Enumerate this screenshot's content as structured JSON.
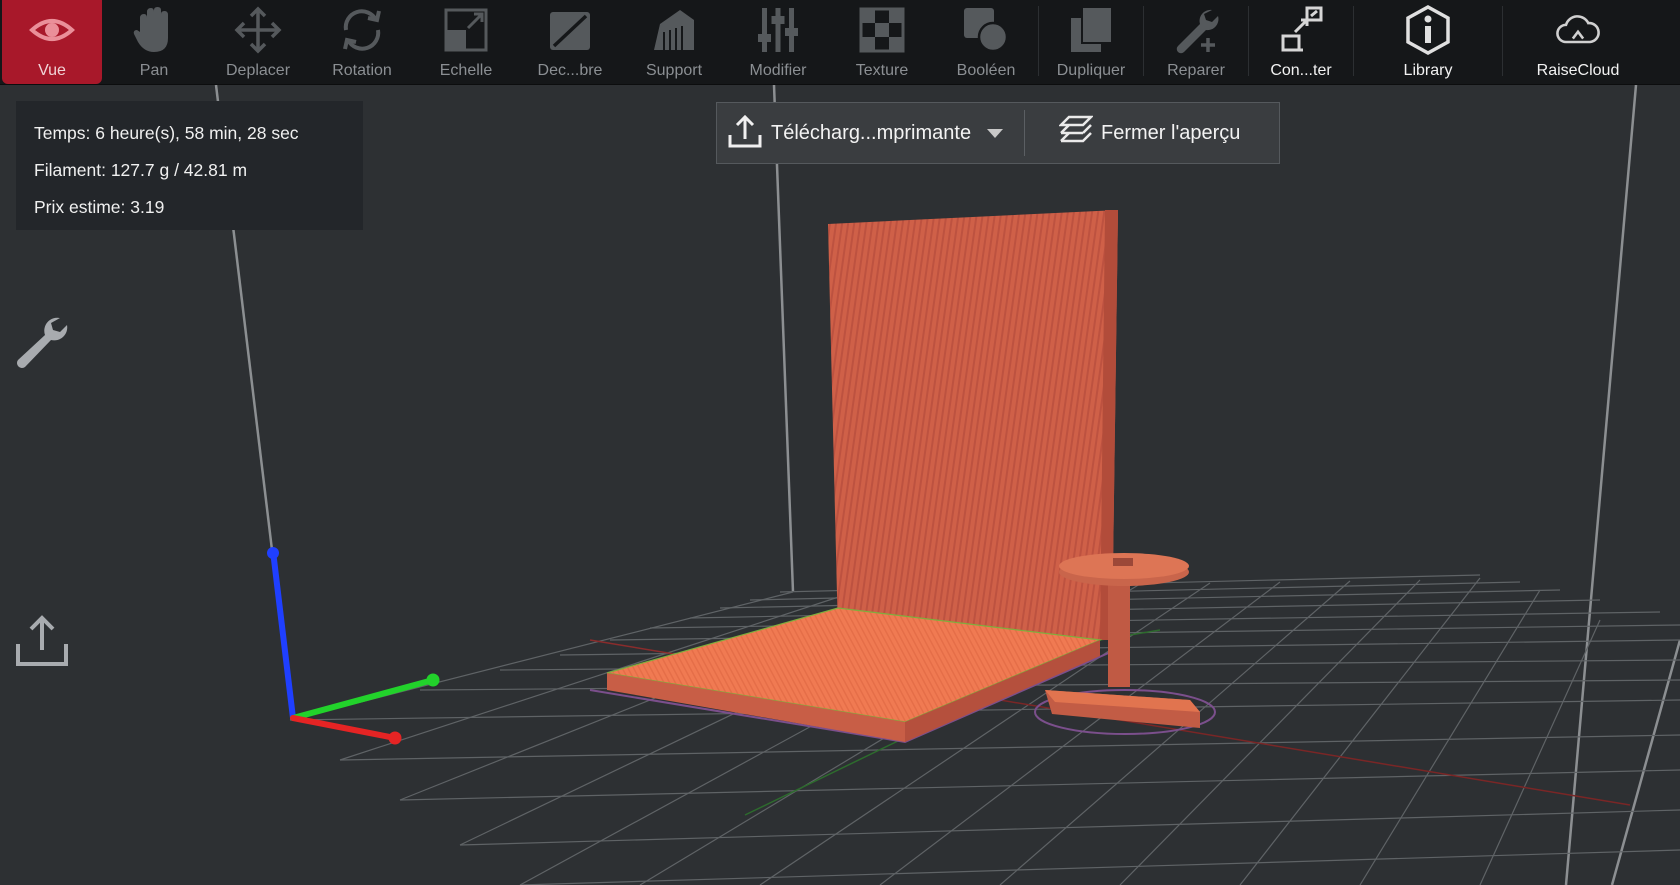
{
  "toolbar": {
    "items": [
      {
        "label": "Vue",
        "icon": "eye-icon",
        "state": "active"
      },
      {
        "label": "Pan",
        "icon": "hand-icon",
        "state": "disabled"
      },
      {
        "label": "Deplacer",
        "icon": "move-icon",
        "state": "disabled"
      },
      {
        "label": "Rotation",
        "icon": "rotate-icon",
        "state": "disabled"
      },
      {
        "label": "Echelle",
        "icon": "scale-icon",
        "state": "disabled"
      },
      {
        "label": "Dec...bre",
        "icon": "cut-icon",
        "state": "disabled"
      },
      {
        "label": "Support",
        "icon": "support-icon",
        "state": "disabled"
      },
      {
        "label": "Modifier",
        "icon": "sliders-icon",
        "state": "disabled"
      },
      {
        "label": "Texture",
        "icon": "checker-icon",
        "state": "disabled"
      },
      {
        "label": "Booléen",
        "icon": "boolean-icon",
        "state": "disabled"
      },
      {
        "label": "Dupliquer",
        "icon": "duplicate-icon",
        "state": "disabled"
      },
      {
        "label": "Reparer",
        "icon": "wrench-plus-icon",
        "state": "disabled"
      },
      {
        "label": "Con...ter",
        "icon": "connect-icon",
        "state": "enabled"
      },
      {
        "label": "Library",
        "icon": "info-icon",
        "state": "enabled"
      },
      {
        "label": "RaiseCloud",
        "icon": "cloud-icon",
        "state": "enabled"
      }
    ]
  },
  "stats": {
    "time": "Temps: 6 heure(s), 58 min, 28 sec",
    "filament": "Filament: 127.7 g / 42.81 m",
    "price": "Prix estime: 3.19"
  },
  "preview": {
    "upload_label": "Télécharg...mprimante",
    "close_label": "Fermer l'aperçu"
  },
  "sidebar": {
    "tools_icon": "wrench-icon",
    "export_icon": "upload-icon"
  },
  "colors": {
    "accent": "#a8182a",
    "model": "#e8704f",
    "background": "#2d3033",
    "toolbar": "#151719"
  }
}
